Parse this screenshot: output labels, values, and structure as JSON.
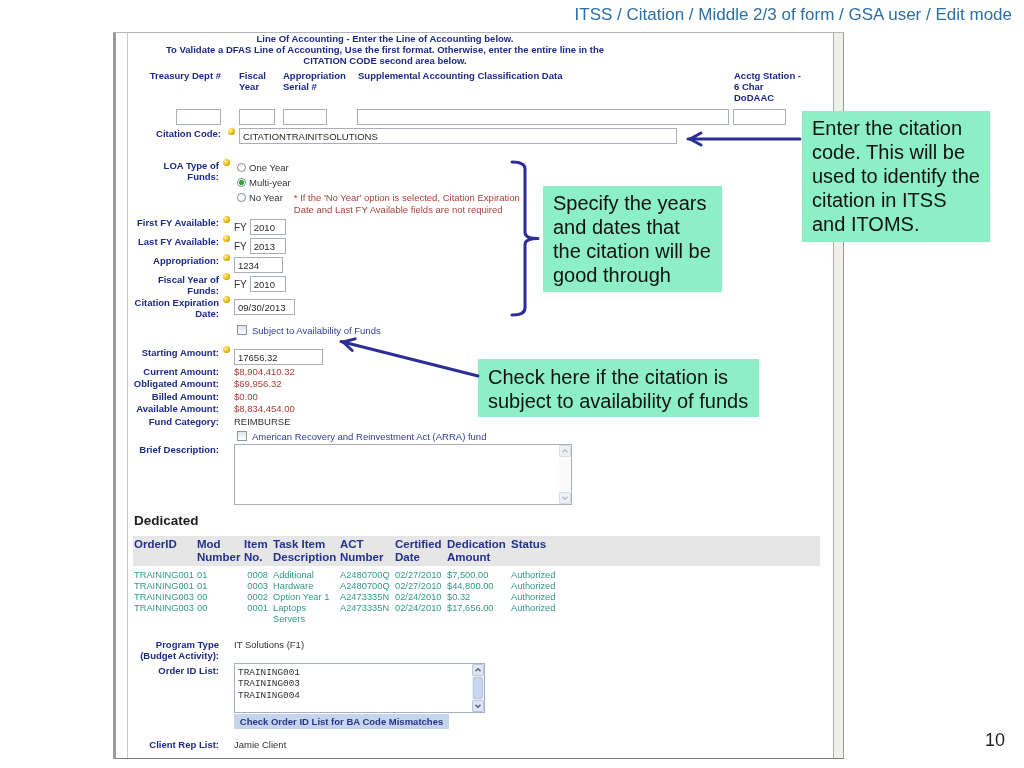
{
  "slide": {
    "breadcrumb": "ITSS / Citation / Middle 2/3 of form / GSA user / Edit mode",
    "page_number": "10"
  },
  "line_of_accounting": {
    "title": "Line Of Accounting - Enter the Line of Accounting below.",
    "instructions": "To Validate a DFAS Line of Accounting, Use the first format. Otherwise, enter the entire line in the CITATION CODE second area below.",
    "columns": [
      "Treasury Dept #",
      "Fiscal Year",
      "Appropriation Serial #",
      "Supplemental Accounting Classification Data",
      "Acctg Station - 6 Char DoDAAC"
    ],
    "citation_code": {
      "label": "Citation Code:",
      "required": true,
      "value": "CITATIONTRAINITSOLUTIONS"
    }
  },
  "fields": [
    {
      "kind": "radio",
      "label": "LOA Type of Funds:",
      "required": true,
      "options": [
        {
          "label": "One Year",
          "selected": false
        },
        {
          "label": "Multi-year",
          "selected": true
        },
        {
          "label": "No Year",
          "selected": false,
          "note": "* If the 'No Year' option is selected, Citation Expiration Date and Last FY Available fields are not required"
        }
      ]
    },
    {
      "kind": "year",
      "label": "First FY Available:",
      "required": true,
      "prefix": "FY",
      "value": "2010"
    },
    {
      "kind": "year",
      "label": "Last FY Available:",
      "required": true,
      "prefix": "FY",
      "value": "2013"
    },
    {
      "kind": "code",
      "label": "Appropriation:",
      "required": true,
      "value": "1234"
    },
    {
      "kind": "year",
      "label": "Fiscal Year of Funds:",
      "required": true,
      "prefix": "FY",
      "value": "2010"
    },
    {
      "kind": "date",
      "label": "Citation Expiration Date:",
      "required": true,
      "value": "09/30/2013"
    },
    {
      "kind": "check",
      "label": "Subject to Availability of Funds",
      "required": false,
      "checked": false
    },
    {
      "kind": "money",
      "label": "Starting Amount:",
      "required": true,
      "value": "17656.32"
    },
    {
      "kind": "amount",
      "label": "Current Amount:",
      "required": false,
      "value": "$8,904,410.32"
    },
    {
      "kind": "amount",
      "label": "Obligated Amount:",
      "required": false,
      "value": "$69,956.32"
    },
    {
      "kind": "amount",
      "label": "Billed Amount:",
      "required": false,
      "value": "$0.00"
    },
    {
      "kind": "amount",
      "label": "Available Amount:",
      "required": false,
      "value": "$8,834,454.00"
    },
    {
      "kind": "text",
      "label": "Fund Category:",
      "required": false,
      "value": "REIMBURSE"
    },
    {
      "kind": "check",
      "label": "American Recovery and Reinvestment Act (ARRA) fund",
      "required": false,
      "checked": false
    },
    {
      "kind": "memo",
      "label": "Brief Description:",
      "required": false
    }
  ],
  "dedicated": {
    "title": "Dedicated",
    "columns": [
      "OrderID",
      "Mod Number",
      "Item No.",
      "Task Item Description",
      "ACT Number",
      "Certified Date",
      "Dedication Amount",
      "Status"
    ],
    "rows": [
      [
        "TRAINING001",
        "01",
        "0008",
        "Additional",
        "A2480700Q",
        "02/27/2010",
        "$7,500.00",
        "Authorized"
      ],
      [
        "TRAINING001",
        "01",
        "0003",
        "Hardware",
        "A2480700Q",
        "02/27/2010",
        "$44,800.00",
        "Authorized"
      ],
      [
        "TRAINING003",
        "00",
        "0002",
        "Option Year 1",
        "A2473335N",
        "02/24/2010",
        "$0.32",
        "Authorized"
      ],
      [
        "TRAINING003",
        "00",
        "0001",
        "Laptops Servers",
        "A2473335N",
        "02/24/2010",
        "$17,656.00",
        "Authorized"
      ]
    ]
  },
  "program": [
    {
      "kind": "text",
      "label": "Program Type (Budget Activity):",
      "required": false,
      "value": "IT Solutions (F1)"
    },
    {
      "kind": "list",
      "label": "Order ID List:",
      "required": false,
      "items": [
        "TRAINING001",
        "TRAINING003",
        "TRAINING004"
      ],
      "button": "Check Order ID List for BA Code Mismatches"
    },
    {
      "kind": "text",
      "label": "Client Rep List:",
      "required": false,
      "value": "Jamie Client"
    }
  ],
  "callouts": [
    {
      "kind": "arrow",
      "text": "Enter the citation code. This will be used to identify the citation in ITSS and ITOMS."
    },
    {
      "kind": "bracket",
      "text": "Specify the years and dates that the citation will be good through"
    },
    {
      "kind": "arrow",
      "text": "Check here if the citation is subject to availability of funds"
    }
  ]
}
